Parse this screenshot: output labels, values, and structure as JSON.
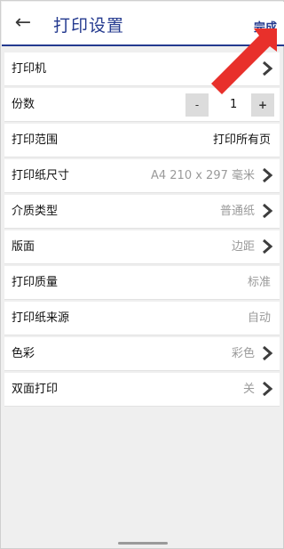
{
  "header": {
    "title": "打印设置",
    "done_label": "完成",
    "back_icon": "back-arrow-icon",
    "accent": "#243a8f"
  },
  "rows": [
    {
      "label": "打印机",
      "value": "",
      "arrow": true
    },
    {
      "label": "份数",
      "stepper": {
        "minus": "-",
        "value": "1",
        "plus": "+"
      }
    },
    {
      "label": "打印范围",
      "value": "打印所有页",
      "arrow": false
    },
    {
      "label": "打印纸尺寸",
      "value": "A4 210 x 297 毫米",
      "arrow": true
    },
    {
      "label": "介质类型",
      "value": "普通纸",
      "arrow": true
    },
    {
      "label": "版面",
      "value": "边距",
      "arrow": true
    },
    {
      "label": "打印质量",
      "value": "标准",
      "arrow": false
    },
    {
      "label": "打印纸来源",
      "value": "自动",
      "arrow": false
    },
    {
      "label": "色彩",
      "value": "彩色",
      "arrow": true
    },
    {
      "label": "双面打印",
      "value": "关",
      "arrow": true
    }
  ],
  "annotation": {
    "pointer_color": "#e8302b"
  }
}
